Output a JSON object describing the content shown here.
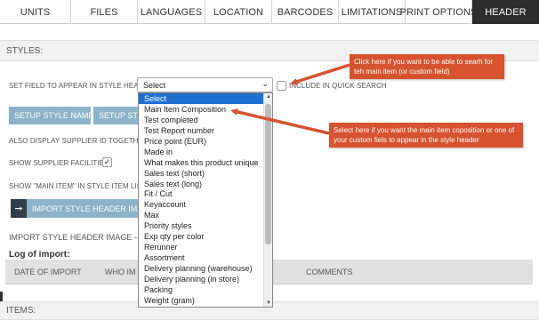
{
  "tabs": [
    {
      "label": "UNITS",
      "active": false
    },
    {
      "label": "FILES",
      "active": false
    },
    {
      "label": "LANGUAGES",
      "active": false
    },
    {
      "label": "LOCATION",
      "active": false
    },
    {
      "label": "BARCODES",
      "active": false
    },
    {
      "label": "LIMITATIONS",
      "active": false
    },
    {
      "label": "PRINT OPTIONS",
      "active": false
    },
    {
      "label": "HEADER",
      "active": true
    }
  ],
  "styles_section": {
    "title": "STYLES:"
  },
  "form": {
    "set_field_label": "SET FIELD TO APPEAR IN STYLE HEADER:",
    "select_value": "Select",
    "include_quick_search_label": "INCLUDE IN QUICK SEARCH",
    "setup_style_name_label": "SETUP STYLE NAME",
    "setup_style_label": "SETUP STYL",
    "also_display_label": "ALSO DISPLAY SUPPLIER ID TOGETHER W",
    "show_supplier_facilities_label": "SHOW SUPPLIER FACILITIES:",
    "show_main_item_label": "SHOW \"MAIN ITEM\" IN STYLE ITEM LIST:",
    "import_header_button_label": "IMPORT STYLE HEADER IMAGE",
    "import_header_section_label": "IMPORT STYLE HEADER IMAGE - LO",
    "log_title": "Log of import:"
  },
  "log_table": {
    "headers": [
      "DATE OF IMPORT",
      "WHO IM",
      "COMMENTS"
    ]
  },
  "items_section": {
    "title": "ITEMS:"
  },
  "dropdown": {
    "options": [
      "Select",
      "Main Item Composition",
      "Test completed",
      "Test Report number",
      "Price point (EUR)",
      "Made in",
      "What makes this product unique",
      "Sales text (short)",
      "Sales text (long)",
      "Fit / Cut",
      "Keyaccount",
      "Max",
      "Priority styles",
      "Exp qty per color",
      "Rerunner",
      "Assortment",
      "Delivery planning (warehouse)",
      "Delivery planning (in store)",
      "Packing",
      "Weight (gram)"
    ],
    "highlighted": "Select"
  },
  "callouts": {
    "top": "Click here if you want to be able to searh for teh main item (or custom field)",
    "middle": "Select here if you want the main item coposition or one of your custom fiels to appear in the style header"
  },
  "colors": {
    "callout": "#d65230",
    "tab_active": "#2d2d2d",
    "button": "#8bb3c9",
    "highlight": "#1f6fd1"
  }
}
